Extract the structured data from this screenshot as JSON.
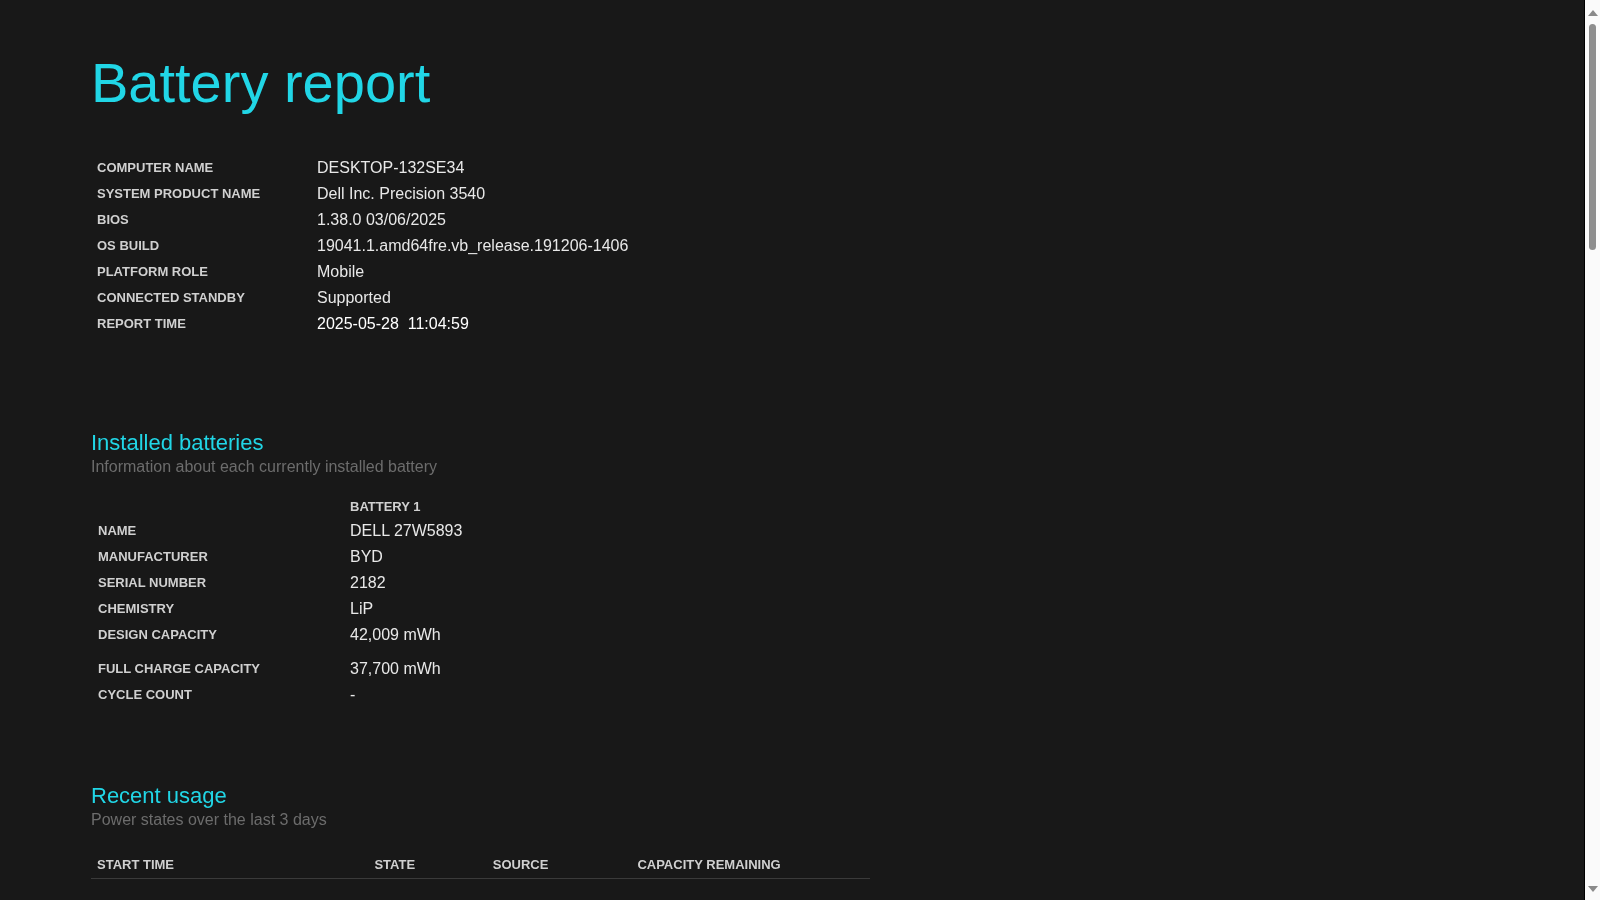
{
  "title": "Battery report",
  "system_info": [
    {
      "label": "COMPUTER NAME",
      "value": "DESKTOP-132SE34"
    },
    {
      "label": "SYSTEM PRODUCT NAME",
      "value": "Dell Inc. Precision 3540"
    },
    {
      "label": "BIOS",
      "value": "1.38.0 03/06/2025"
    },
    {
      "label": "OS BUILD",
      "value": "19041.1.amd64fre.vb_release.191206-1406"
    },
    {
      "label": "PLATFORM ROLE",
      "value": "Mobile"
    },
    {
      "label": "CONNECTED STANDBY",
      "value": "Supported"
    },
    {
      "label": "REPORT TIME",
      "value": "2025-05-28  11:04:59"
    }
  ],
  "installed_batteries": {
    "heading": "Installed batteries",
    "description": "Information about each currently installed battery",
    "column": "BATTERY 1",
    "rows": [
      {
        "label": "NAME",
        "value": "DELL 27W5893"
      },
      {
        "label": "MANUFACTURER",
        "value": "BYD"
      },
      {
        "label": "SERIAL NUMBER",
        "value": "2182"
      },
      {
        "label": "CHEMISTRY",
        "value": "LiP"
      },
      {
        "label": "DESIGN CAPACITY",
        "value": "42,009 mWh"
      },
      {
        "label": "FULL CHARGE CAPACITY",
        "value": "37,700 mWh"
      },
      {
        "label": "CYCLE COUNT",
        "value": "-"
      }
    ]
  },
  "recent_usage": {
    "heading": "Recent usage",
    "description": "Power states over the last 3 days",
    "columns": [
      "START TIME",
      "STATE",
      "SOURCE",
      "CAPACITY REMAINING"
    ]
  }
}
